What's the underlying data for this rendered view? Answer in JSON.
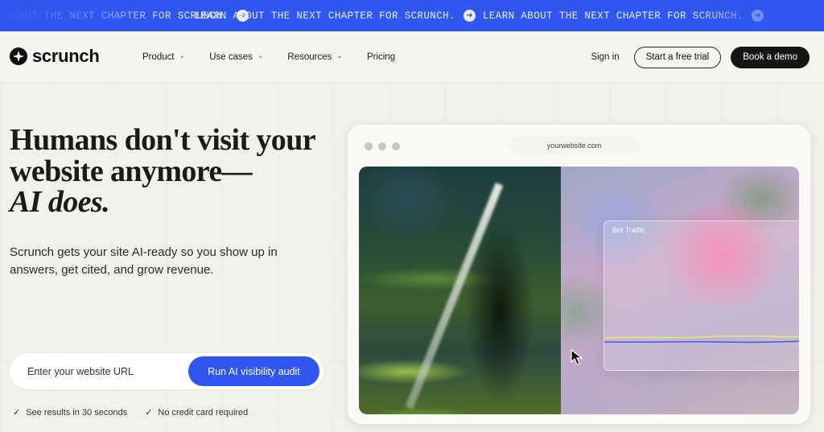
{
  "banner": {
    "text": "LEARN ABOUT THE NEXT CHAPTER FOR SCRUNCH.",
    "partial_text": "CHAPTER FOR SCRUNCH.",
    "arrow_icon": "arrow-right-circle-icon"
  },
  "nav": {
    "logo_text": "scrunch",
    "logo_icon": "sparkle-star-icon",
    "menu": [
      {
        "label": "Product",
        "has_dropdown": true
      },
      {
        "label": "Use cases",
        "has_dropdown": true
      },
      {
        "label": "Resources",
        "has_dropdown": true
      },
      {
        "label": "Pricing",
        "has_dropdown": false
      }
    ],
    "signin": "Sign in",
    "trial_button": "Start a free trial",
    "demo_button": "Book a demo"
  },
  "hero": {
    "headline_line1": "Humans don't visit your",
    "headline_line2": "website anymore—",
    "headline_line3": "AI does.",
    "subtext": "Scrunch gets your site AI-ready so you show up in answers, get cited, and grow revenue.",
    "url_placeholder": "Enter your website URL",
    "audit_button": "Run AI visibility audit",
    "checks": [
      "See results in 30 seconds",
      "No credit card required"
    ]
  },
  "browser": {
    "address": "yourwebsite.com",
    "panel_title": "Bot Traffic",
    "panel_line_colors": [
      "#e6ea6a",
      "#3a5cf0"
    ]
  },
  "colors": {
    "accent": "#2f57ef",
    "dark": "#151515",
    "background": "#f3f1ec"
  }
}
